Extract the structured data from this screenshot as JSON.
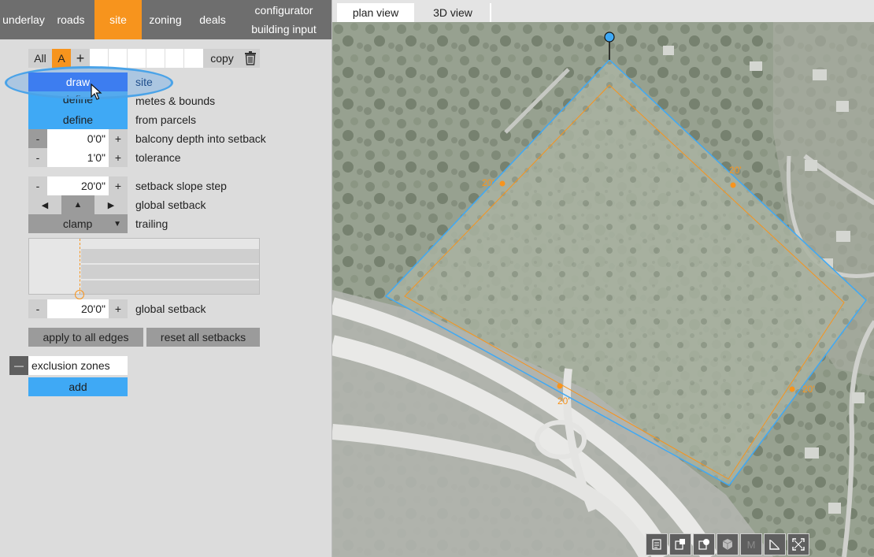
{
  "nav": {
    "tabs": [
      "underlay",
      "roads",
      "site",
      "zoning",
      "deals"
    ],
    "active": "site",
    "config_line1": "configurator",
    "config_line2": "building input"
  },
  "site_row": {
    "all_label": "All",
    "site_a_label": "A",
    "add_label": "+",
    "copy_label": "copy"
  },
  "draw": {
    "button_label": "draw",
    "side_label": "site"
  },
  "metes": {
    "button_label": "define",
    "side_label": "metes & bounds"
  },
  "parcels": {
    "button_label": "define",
    "side_label": "from parcels"
  },
  "balcony": {
    "minus": "-",
    "value": "0'0\"",
    "plus": "+",
    "label": "balcony depth into setback"
  },
  "tolerance": {
    "minus": "-",
    "value": "1'0\"",
    "plus": "+",
    "label": "tolerance"
  },
  "slope": {
    "minus": "-",
    "value": "20'0\"",
    "plus": "+",
    "label": "setback slope step"
  },
  "global_setback_arrows": {
    "left": "◀",
    "up": "▲",
    "right": "▶",
    "label": "global setback"
  },
  "trailing": {
    "value": "clamp",
    "caret": "▼",
    "label": "trailing"
  },
  "global_setback": {
    "minus": "-",
    "value": "20'0\"",
    "plus": "+",
    "label": "global setback"
  },
  "actions": {
    "apply_label": "apply to all edges",
    "reset_label": "reset all setbacks"
  },
  "exclusion": {
    "collapse": "—",
    "title": "exclusion zones",
    "add_label": "add"
  },
  "map": {
    "tabs": [
      "plan view",
      "3D view"
    ],
    "active_tab": "plan view",
    "setback_labels": [
      "20'",
      "20'",
      "20'",
      "20'"
    ],
    "tools": [
      "report-icon",
      "layers-icon",
      "overlay-icon",
      "cube-icon",
      "M",
      "measure-icon",
      "fullscreen-icon"
    ]
  },
  "colors": {
    "accent_orange": "#f7941d",
    "button_blue": "#3fa9f5",
    "draw_blue": "#3d7df0",
    "site_line": "#3fa9f5",
    "setback_line": "#f7941d"
  }
}
